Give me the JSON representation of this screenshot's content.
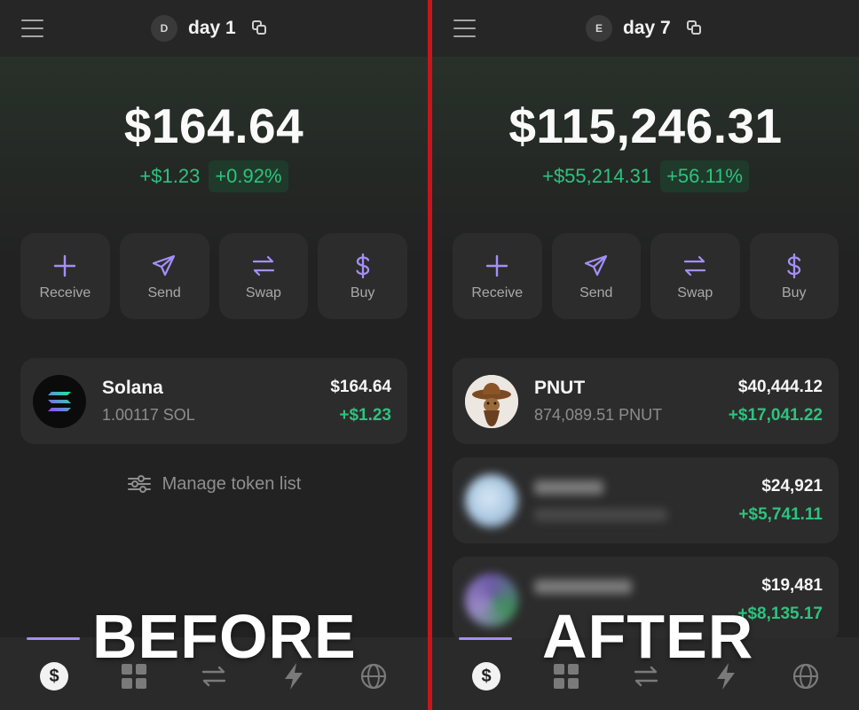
{
  "left": {
    "header": {
      "avatar_letter": "D",
      "account_name": "day 1"
    },
    "balance": "$164.64",
    "change_abs": "+$1.23",
    "change_pct": "+0.92%",
    "actions": [
      {
        "label": "Receive",
        "icon": "plus-icon"
      },
      {
        "label": "Send",
        "icon": "send-icon"
      },
      {
        "label": "Swap",
        "icon": "swap-icon"
      },
      {
        "label": "Buy",
        "icon": "dollar-icon"
      }
    ],
    "tokens": [
      {
        "name": "Solana",
        "amount": "1.00117 SOL",
        "value": "$164.64",
        "change": "+$1.23"
      }
    ],
    "manage_label": "Manage token list",
    "overlay": "BEFORE"
  },
  "right": {
    "header": {
      "avatar_letter": "E",
      "account_name": "day 7"
    },
    "balance": "$115,246.31",
    "change_abs": "+$55,214.31",
    "change_pct": "+56.11%",
    "actions": [
      {
        "label": "Receive",
        "icon": "plus-icon"
      },
      {
        "label": "Send",
        "icon": "send-icon"
      },
      {
        "label": "Swap",
        "icon": "swap-icon"
      },
      {
        "label": "Buy",
        "icon": "dollar-icon"
      }
    ],
    "tokens": [
      {
        "name": "PNUT",
        "amount": "874,089.51 PNUT",
        "value": "$40,444.12",
        "change": "+$17,041.22"
      },
      {
        "name": "",
        "amount": "",
        "value": "$24,921",
        "change": "+$5,741.11"
      },
      {
        "name": "",
        "amount": "",
        "value": "$19,481",
        "change": "+$8,135.17"
      }
    ],
    "overlay": "AFTER"
  },
  "colors": {
    "accent": "#a48ff6",
    "positive": "#2ec27e",
    "divider": "#c8141b"
  },
  "bottom_nav": [
    "dollar-icon",
    "grid-icon",
    "swap-icon",
    "lightning-icon",
    "globe-icon"
  ]
}
